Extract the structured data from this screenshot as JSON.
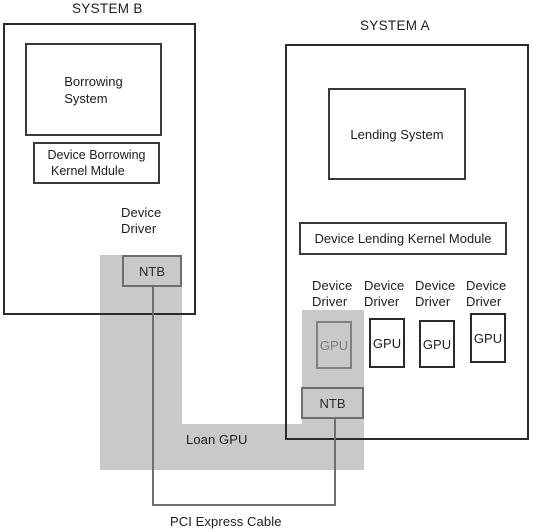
{
  "diagram": {
    "title_system_b": "SYSTEM B",
    "title_system_a": "SYSTEM A",
    "system_b": {
      "borrowing_system": "Borrowing\nSystem",
      "device_borrowing_kernel_module": "Device Borrowing\n Kernel Mdule",
      "device_driver": "Device\nDriver",
      "ntb": "NTB"
    },
    "system_a": {
      "lending_system": "Lending System",
      "device_lending_kernel_module": "Device Lending Kernel Module",
      "device_drivers": [
        "Device\nDriver",
        "Device\nDriver",
        "Device\nDriver",
        "Device\nDriver"
      ],
      "gpus": [
        "GPU",
        "GPU",
        "GPU",
        "GPU"
      ],
      "ntb": "NTB"
    },
    "loan_gpu_label": "Loan GPU",
    "pci_express_cable_label": "PCI Express Cable",
    "colors": {
      "highlight_band": "#c9c9c9",
      "box_border": "#2a2a2a",
      "ntb_border": "#6e6e6e",
      "text": "#1c1c1c",
      "background": "#ffffff"
    }
  }
}
